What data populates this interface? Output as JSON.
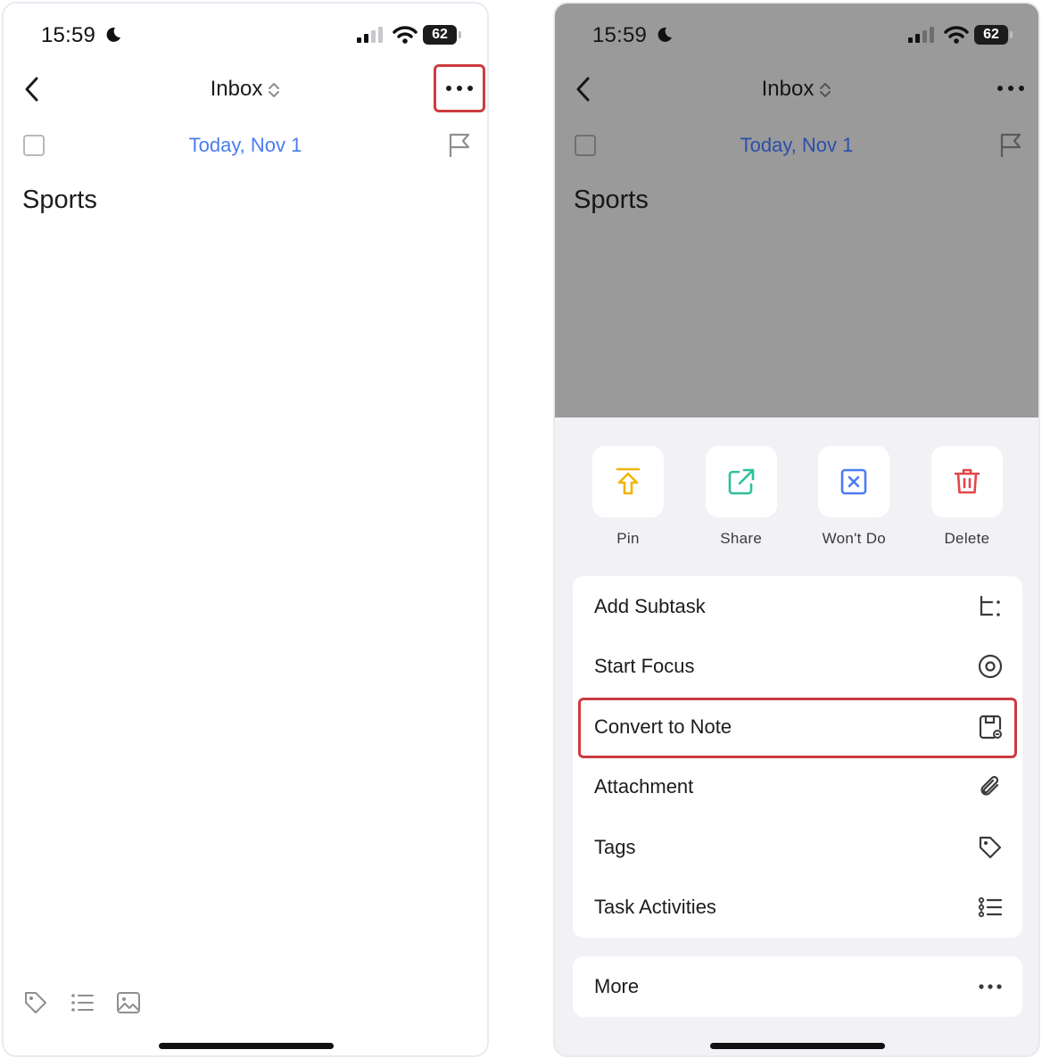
{
  "status": {
    "time": "15:59",
    "battery": "62"
  },
  "nav": {
    "title": "Inbox"
  },
  "task": {
    "date": "Today, Nov 1",
    "title": "Sports"
  },
  "actions": [
    {
      "label": "Pin",
      "icon": "pin-icon",
      "color": "#f0b400"
    },
    {
      "label": "Share",
      "icon": "share-icon",
      "color": "#2bc09a"
    },
    {
      "label": "Won't Do",
      "icon": "wont-do-icon",
      "color": "#4a7cf0"
    },
    {
      "label": "Delete",
      "icon": "trash-icon",
      "color": "#e0474c"
    }
  ],
  "menu": {
    "items": [
      {
        "label": "Add Subtask",
        "icon": "subtask-icon"
      },
      {
        "label": "Start Focus",
        "icon": "focus-icon"
      },
      {
        "label": "Convert to Note",
        "icon": "note-icon"
      },
      {
        "label": "Attachment",
        "icon": "paperclip-icon"
      },
      {
        "label": "Tags",
        "icon": "tag-icon"
      },
      {
        "label": "Task Activities",
        "icon": "activity-list-icon"
      }
    ],
    "more_label": "More"
  },
  "colors": {
    "accent_blue": "#4a7cf0",
    "highlight_red": "#cc3b3f",
    "dim_overlay": "#9a9a9a",
    "sheet_bg": "#f2f2f6"
  }
}
